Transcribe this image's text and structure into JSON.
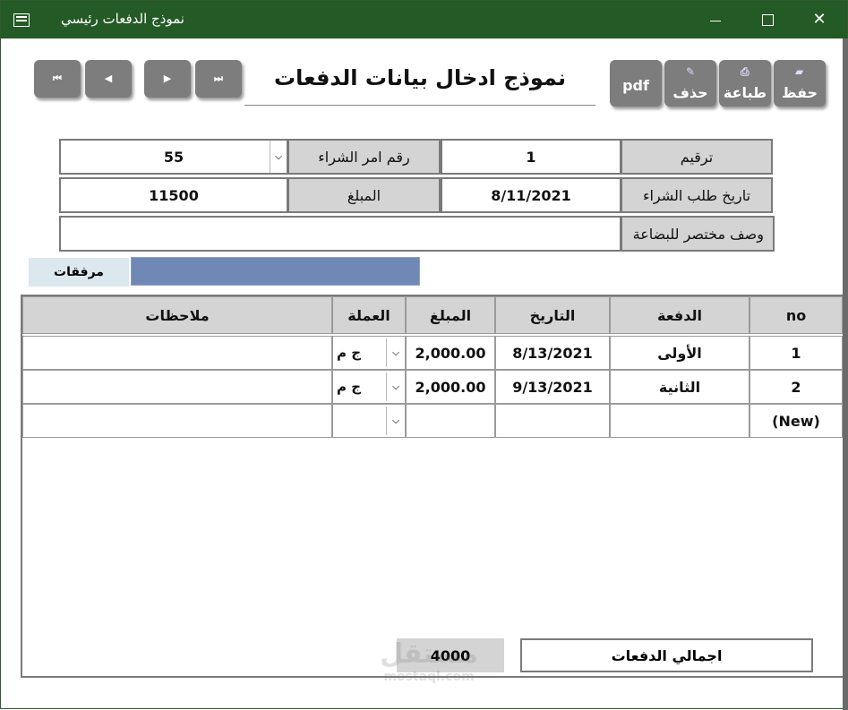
{
  "window": {
    "title": "نموذج الدفعات رئيسي",
    "close_glyph": "✕"
  },
  "form": {
    "title": "نموذج ادخال بيانات الدفعات"
  },
  "nav": {
    "first": "⏮",
    "prev": "◀",
    "next": "▶",
    "last": "⏭"
  },
  "actions": {
    "save": "حفظ",
    "print": "طباعة",
    "delete": "حذف",
    "pdf": "pdf"
  },
  "fields": {
    "serial_label": "ترقيم",
    "serial_value": "1",
    "po_number_label": "رقم امر الشراء",
    "po_number_value": "55",
    "po_date_label": "تاريخ طلب الشراء",
    "po_date_value": "8/11/2021",
    "amount_label": "المبلغ",
    "amount_value": "11500",
    "desc_label": "وصف مختصر للبضاعة",
    "desc_value": ""
  },
  "attachments": {
    "label": "مرفقات"
  },
  "grid": {
    "headers": {
      "no": "no",
      "payment": "الدفعة",
      "date": "التاريخ",
      "amount": "المبلغ",
      "currency": "العملة",
      "notes": "ملاحظات"
    },
    "rows": [
      {
        "no": "1",
        "payment": "الأولى",
        "date": "8/13/2021",
        "amount": "2,000.00",
        "currency": "ج م",
        "notes": ""
      },
      {
        "no": "2",
        "payment": "الثانية",
        "date": "9/13/2021",
        "amount": "2,000.00",
        "currency": "ج م",
        "notes": ""
      }
    ],
    "new_row_label": "(New)"
  },
  "totals": {
    "label": "اجمالي الدفعات",
    "value": "4000"
  },
  "watermark": {
    "line1": "مستقل",
    "line2": "mostaql.com"
  },
  "colors": {
    "titlebar": "#245a25",
    "button": "#7d7d7d",
    "label_bg": "#d4d4d4",
    "attachment_box": "#6f88b5"
  }
}
